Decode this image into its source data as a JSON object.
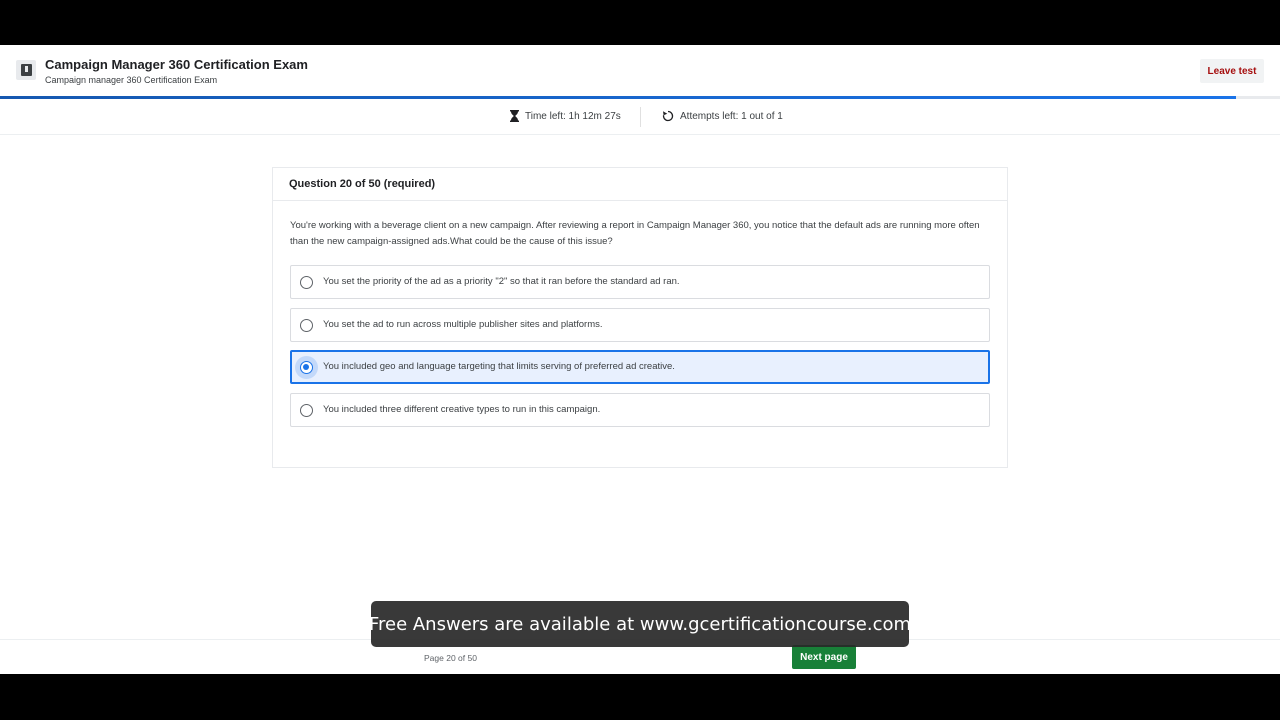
{
  "header": {
    "title": "Campaign Manager 360 Certification Exam",
    "subtitle": "Campaign manager 360 Certification Exam",
    "leave_label": "Leave test",
    "icon": "exam-book-icon"
  },
  "progress": {
    "fraction": 0.966
  },
  "info": {
    "time_left": "Time left: 1h 12m 27s",
    "attempts_left": "Attempts left: 1 out of 1"
  },
  "question": {
    "heading": "Question 20 of 50 (required)",
    "text": "You're working with a beverage client on a new campaign. After reviewing a report in Campaign Manager 360, you notice that the default ads are running more often than the new campaign-assigned ads.What could be the cause of this issue?",
    "options": [
      {
        "label": "You set the priority of the ad as a priority \"2\" so that it ran before the standard ad ran.",
        "selected": false
      },
      {
        "label": "You set the ad to run across multiple publisher sites and platforms.",
        "selected": false
      },
      {
        "label": "You included geo and language targeting that limits serving of preferred ad creative.",
        "selected": true
      },
      {
        "label": "You included three different creative types to run in this campaign.",
        "selected": false
      }
    ]
  },
  "footer": {
    "page_label": "Page 20 of 50",
    "next_label": "Next page"
  },
  "overlay": {
    "caption": "Free Answers are available at www.gcertificationcourse.com"
  },
  "colors": {
    "accent": "#1a73e8",
    "next_button": "#188038",
    "leave_text": "#a50e0e"
  }
}
